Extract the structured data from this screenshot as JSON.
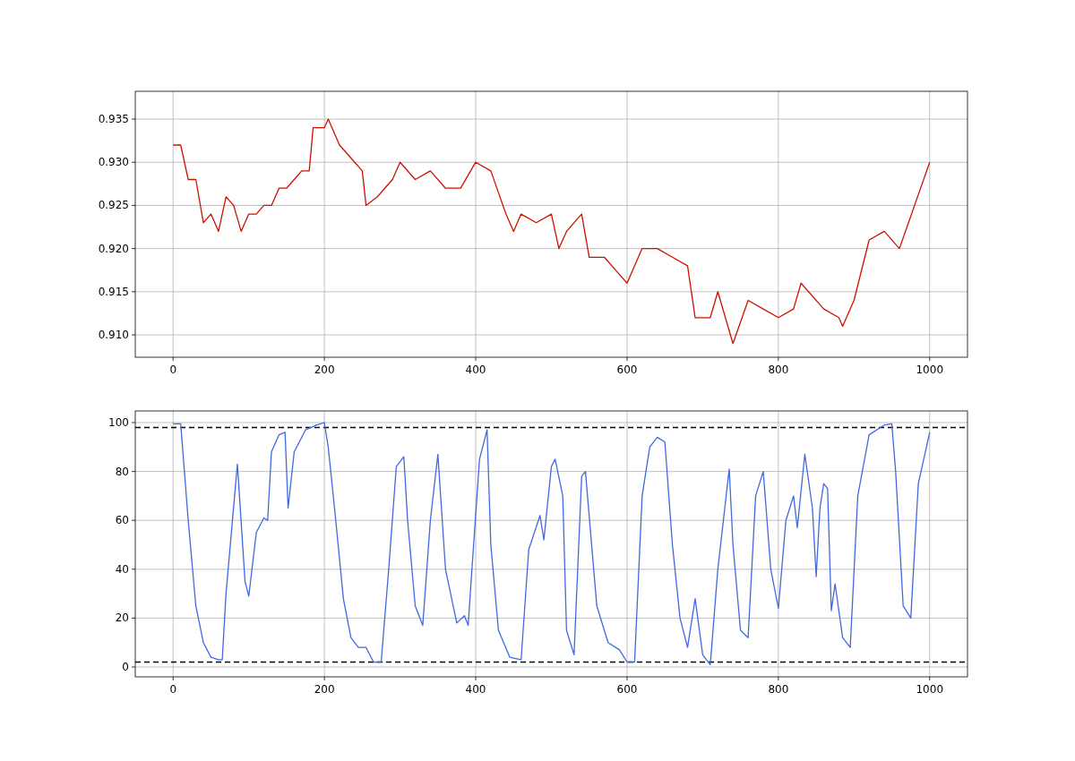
{
  "figure": {
    "panels": [
      {
        "chart_data": {
          "type": "line",
          "xlim": [
            -50,
            1050
          ],
          "ylim": [
            0.90741,
            0.93822
          ],
          "xticks": [
            0,
            200,
            400,
            600,
            800,
            1000
          ],
          "yticks": [
            {
              "value": 0.91,
              "label": "0.910"
            },
            {
              "value": 0.915,
              "label": "0.915"
            },
            {
              "value": 0.92,
              "label": "0.920"
            },
            {
              "value": 0.925,
              "label": "0.925"
            },
            {
              "value": 0.93,
              "label": "0.930"
            },
            {
              "value": 0.935,
              "label": "0.935"
            }
          ],
          "x": [
            0,
            10,
            20,
            30,
            40,
            50,
            60,
            70,
            80,
            90,
            100,
            110,
            120,
            130,
            140,
            150,
            160,
            170,
            180,
            185,
            200,
            205,
            220,
            240,
            250,
            255,
            270,
            290,
            300,
            320,
            340,
            360,
            380,
            400,
            420,
            440,
            450,
            460,
            480,
            500,
            510,
            520,
            540,
            550,
            570,
            590,
            600,
            620,
            640,
            660,
            680,
            690,
            710,
            720,
            740,
            760,
            780,
            800,
            820,
            830,
            860,
            880,
            885,
            900,
            920,
            940,
            960,
            980,
            1000
          ],
          "grid": true,
          "series": [
            {
              "color": "#cc1100",
              "values": [
                0.932,
                0.932,
                0.928,
                0.928,
                0.923,
                0.924,
                0.922,
                0.926,
                0.925,
                0.922,
                0.924,
                0.924,
                0.925,
                0.925,
                0.927,
                0.927,
                0.928,
                0.929,
                0.929,
                0.934,
                0.934,
                0.935,
                0.932,
                0.93,
                0.929,
                0.925,
                0.926,
                0.928,
                0.93,
                0.928,
                0.929,
                0.927,
                0.927,
                0.93,
                0.929,
                0.924,
                0.922,
                0.924,
                0.923,
                0.924,
                0.92,
                0.922,
                0.924,
                0.919,
                0.919,
                0.917,
                0.916,
                0.92,
                0.92,
                0.919,
                0.918,
                0.912,
                0.912,
                0.915,
                0.909,
                0.914,
                0.913,
                0.912,
                0.913,
                0.916,
                0.913,
                0.912,
                0.911,
                0.914,
                0.921,
                0.922,
                0.92,
                0.925,
                0.93
              ]
            }
          ]
        }
      },
      {
        "chart_data": {
          "type": "line",
          "xlim": [
            -50,
            1050
          ],
          "ylim": [
            -4.03,
            104.76
          ],
          "xticks": [
            0,
            200,
            400,
            600,
            800,
            1000
          ],
          "yticks": [
            0,
            20,
            40,
            60,
            80,
            100
          ],
          "x": [
            0,
            10,
            20,
            30,
            40,
            50,
            60,
            65,
            70,
            85,
            95,
            100,
            110,
            120,
            125,
            130,
            140,
            148,
            152,
            160,
            175,
            190,
            200,
            205,
            215,
            225,
            235,
            245,
            255,
            265,
            275,
            285,
            295,
            305,
            310,
            320,
            330,
            340,
            350,
            360,
            375,
            385,
            390,
            395,
            405,
            415,
            420,
            430,
            445,
            460,
            470,
            485,
            490,
            500,
            505,
            515,
            520,
            530,
            540,
            545,
            560,
            575,
            590,
            600,
            610,
            620,
            630,
            640,
            650,
            660,
            670,
            680,
            690,
            700,
            710,
            720,
            735,
            740,
            750,
            760,
            770,
            780,
            790,
            800,
            810,
            820,
            825,
            835,
            845,
            850,
            855,
            860,
            865,
            870,
            875,
            885,
            895,
            905,
            920,
            940,
            950,
            955,
            965,
            975,
            985,
            1000
          ],
          "grid": true,
          "series": [
            {
              "color": "#4169e1",
              "values": [
                99.5,
                99.5,
                60,
                25,
                10,
                4,
                3,
                3,
                30,
                83,
                35,
                29,
                55,
                61,
                60,
                88,
                95,
                96,
                65,
                88,
                97,
                99,
                100,
                90,
                60,
                28,
                12,
                8,
                8,
                2,
                2,
                40,
                82,
                86,
                60,
                25,
                17,
                60,
                87,
                40,
                18,
                21,
                17,
                40,
                85,
                97,
                50,
                15,
                4,
                3,
                48,
                62,
                52,
                82,
                85,
                70,
                15,
                5,
                78,
                80,
                25,
                10,
                7,
                2,
                2,
                70,
                90,
                94,
                92,
                50,
                20,
                8,
                28,
                5,
                1,
                40,
                81,
                50,
                15,
                12,
                70,
                80,
                40,
                24,
                60,
                70,
                57,
                87,
                65,
                37,
                65,
                75,
                73,
                23,
                34,
                12,
                8,
                70,
                95,
                99,
                99.5,
                80,
                25,
                20,
                75,
                96
              ]
            }
          ],
          "ref_lines": [
            {
              "axis": "y",
              "value": 98,
              "color": "#000000"
            },
            {
              "axis": "y",
              "value": 2,
              "color": "#000000"
            }
          ]
        }
      }
    ]
  }
}
